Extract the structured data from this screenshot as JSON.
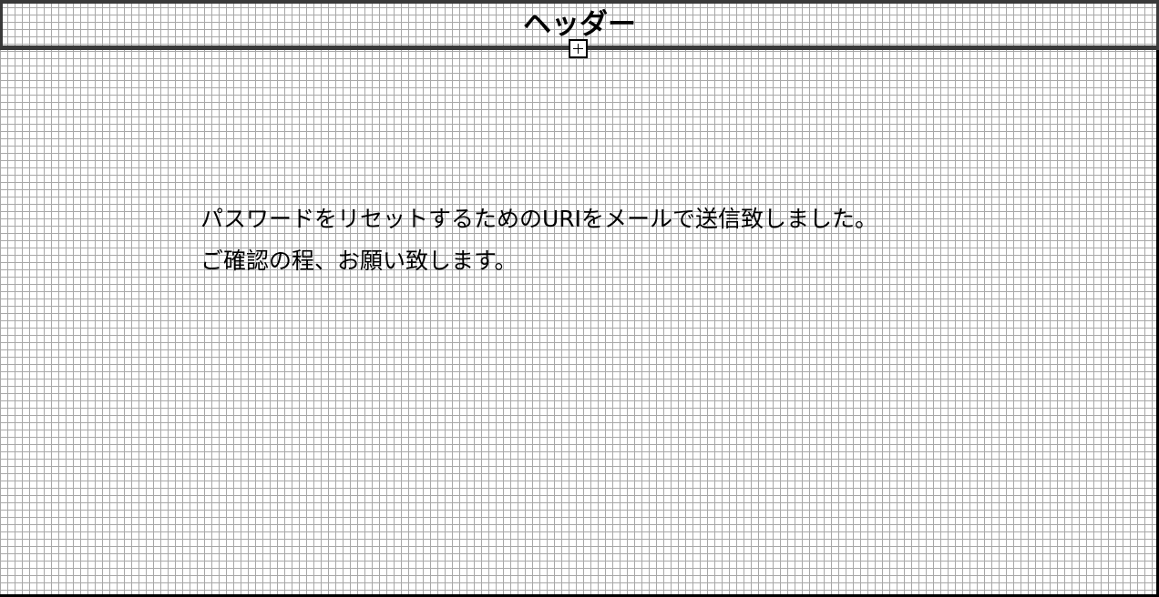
{
  "header": {
    "title": "ヘッダー",
    "expand_icon": "plus-square-icon"
  },
  "main": {
    "message_lines": [
      "パスワードをリセットするためのURIをメールで送信致しました。",
      "ご確認の程、お願い致します。"
    ]
  }
}
